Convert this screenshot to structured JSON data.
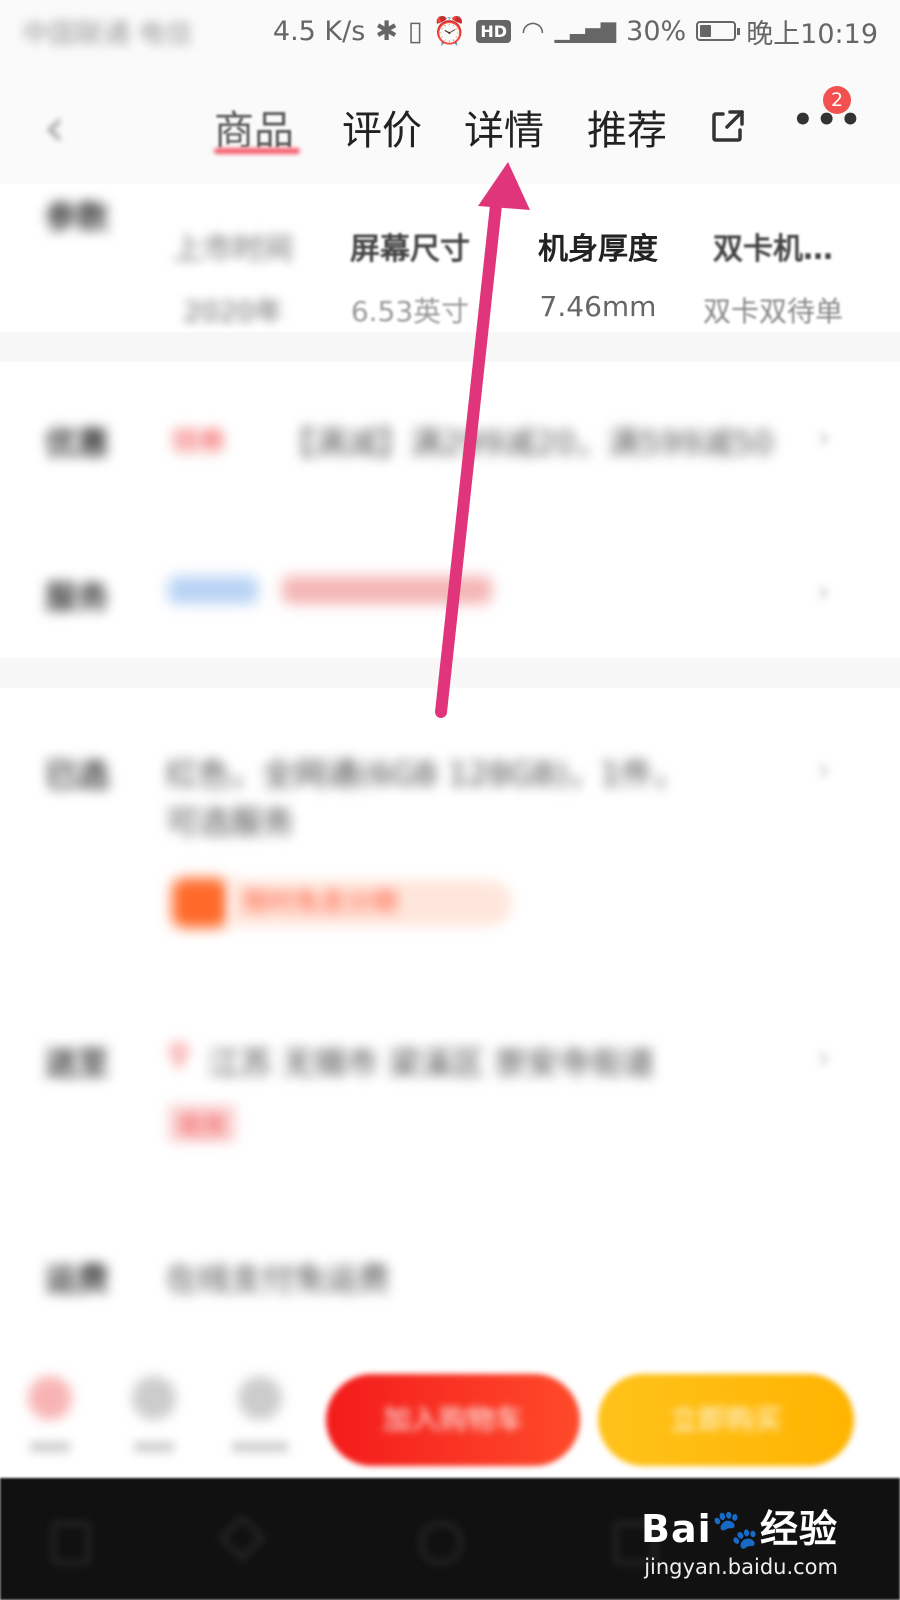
{
  "status_bar": {
    "left_text": "中国联通 电信",
    "net_speed": "4.5 K/s",
    "battery": "30%",
    "battery_level": 0.3,
    "time": "晚上10:19"
  },
  "nav": {
    "tabs": [
      "商品",
      "评价",
      "详情",
      "推荐"
    ],
    "active_tab_index": 0,
    "badge_count": "2"
  },
  "params": [
    {
      "name": "上市时间",
      "value": "2020年"
    },
    {
      "name": "屏幕尺寸",
      "value": "6.53英寸"
    },
    {
      "name": "机身厚度",
      "value": "7.46mm"
    },
    {
      "name": "双卡机…",
      "value": "双卡双待单"
    }
  ],
  "sections": {
    "param_label": "参数",
    "promo_label": "优惠",
    "promo_tag": "领券",
    "promo_text": "【满减】满299减20，满599减50",
    "service_label": "服务",
    "chosen_label": "已选",
    "chosen_text": "红色，全网通(6GB 128GB)，1件，可选服务",
    "chosen_tag": "限时免息分期",
    "deliver_label": "送至",
    "deliver_text": "江苏 无锡市 梁溪区 崇安寺街道",
    "deliver_tag": "现货",
    "freight_label": "运费",
    "freight_text": "在线支付免运费"
  },
  "actions": {
    "icons": [
      "店铺",
      "客服",
      "购物车"
    ],
    "add_cart": "加入购物车",
    "buy_now": "立即购买"
  },
  "colors": {
    "accent_red": "#f31b1b",
    "accent_orange": "#ffb400",
    "annotation": "#e0357a"
  },
  "watermark": {
    "logo": "Bai🐾经验",
    "url": "jingyan.baidu.com"
  }
}
